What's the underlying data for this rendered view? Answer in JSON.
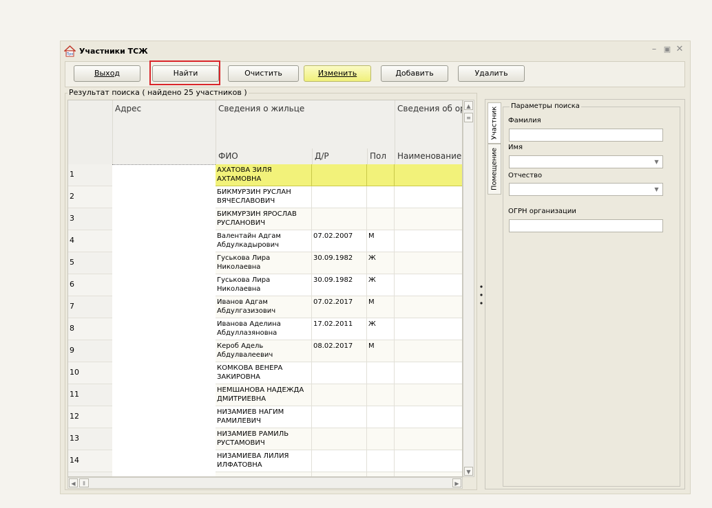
{
  "window": {
    "title": "Участники ТСЖ",
    "icon": "house-icon",
    "icon_text": "Про"
  },
  "toolbar": {
    "exit": "Выход",
    "find": "Найти",
    "clear": "Очистить",
    "edit": "Изменить",
    "add": "Добавить",
    "delete": "Удалить"
  },
  "results": {
    "legend": "Результат поиска  ( найдено 25 участников )",
    "group_headers": {
      "address": "Адрес",
      "resident": "Сведения о жильце",
      "org": "Сведения об орг"
    },
    "columns": {
      "fio": "ФИО",
      "dob": "Д/Р",
      "sex": "Пол",
      "name": "Наименование"
    },
    "rows": [
      {
        "num": "1",
        "fio1": "АХАТОВА ЗИЛЯ",
        "fio2": "АХТАМОВНА",
        "dob": "",
        "sex": ""
      },
      {
        "num": "2",
        "fio1": "БИКМУРЗИН РУСЛАН",
        "fio2": "ВЯЧЕСЛАВОВИЧ",
        "dob": "",
        "sex": ""
      },
      {
        "num": "3",
        "fio1": "БИКМУРЗИН ЯРОСЛАВ",
        "fio2": "РУСЛАНОВИЧ",
        "dob": "",
        "sex": ""
      },
      {
        "num": "4",
        "fio1": "Валентайн Адгам",
        "fio2": "Абдулкадырович",
        "dob": "07.02.2007",
        "sex": "М"
      },
      {
        "num": "5",
        "fio1": "Гуськова Лира",
        "fio2": "Николаевна",
        "dob": "30.09.1982",
        "sex": "Ж"
      },
      {
        "num": "6",
        "fio1": "Гуськова Лира",
        "fio2": "Николаевна",
        "dob": "30.09.1982",
        "sex": "Ж"
      },
      {
        "num": "7",
        "fio1": "Иванов Адгам",
        "fio2": "Абдулгазизович",
        "dob": "07.02.2017",
        "sex": "М"
      },
      {
        "num": "8",
        "fio1": "Иванова Аделина",
        "fio2": "Абдуллазяновна",
        "dob": "17.02.2011",
        "sex": "Ж"
      },
      {
        "num": "9",
        "fio1": "Кероб Адель",
        "fio2": "Абдулвалеевич",
        "dob": "08.02.2017",
        "sex": "М"
      },
      {
        "num": "10",
        "fio1": "КОМКОВА ВЕНЕРА",
        "fio2": "ЗАКИРОВНА",
        "dob": "",
        "sex": ""
      },
      {
        "num": "11",
        "fio1": "НЕМШАНОВА НАДЕЖДА",
        "fio2": "ДМИТРИЕВНА",
        "dob": "",
        "sex": ""
      },
      {
        "num": "12",
        "fio1": "НИЗАМИЕВ НАГИМ",
        "fio2": "РАМИЛЕВИЧ",
        "dob": "",
        "sex": ""
      },
      {
        "num": "13",
        "fio1": "НИЗАМИЕВ РАМИЛЬ",
        "fio2": "РУСТАМОВИЧ",
        "dob": "",
        "sex": ""
      },
      {
        "num": "14",
        "fio1": "НИЗАМИЕВА ЛИЛИЯ",
        "fio2": "ИЛФАТОВНА",
        "dob": "",
        "sex": ""
      }
    ],
    "selected_row_color": "#f2f27a"
  },
  "side_tabs": {
    "participant": "Участник",
    "premises": "Помещение"
  },
  "search_params": {
    "legend": "Параметры поиска",
    "surname_label": "Фамилия",
    "name_label": "Имя",
    "patronymic_label": "Отчество",
    "ogrn_label": "ОГРН организации"
  }
}
